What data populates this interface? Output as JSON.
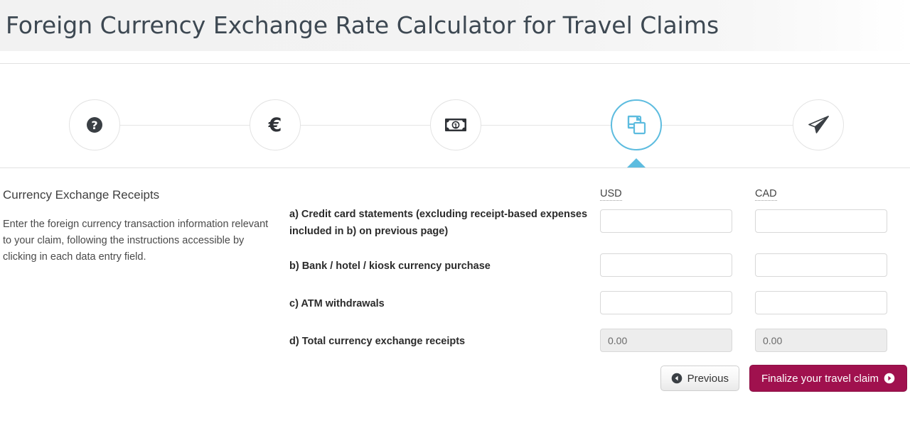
{
  "header": {
    "title": "Foreign Currency Exchange Rate Calculator for Travel Claims"
  },
  "stepper": {
    "active_index": 3,
    "active_color": "#5dbcdf",
    "inactive_border": "#e3e3e3",
    "steps": [
      {
        "icon": "question-mark-circle-icon",
        "label": "Help",
        "state": "inactive"
      },
      {
        "icon": "euro-currency-icon",
        "label": "Currency",
        "state": "inactive",
        "glyph": "€"
      },
      {
        "icon": "banknote-money-icon",
        "label": "Cash",
        "state": "inactive"
      },
      {
        "icon": "copy-documents-icon",
        "label": "Currency Exchange Receipts",
        "state": "active"
      },
      {
        "icon": "paper-plane-send-icon",
        "label": "Submit",
        "state": "inactive"
      }
    ]
  },
  "main": {
    "section_title": "Currency Exchange Receipts",
    "section_description": "Enter the foreign currency transaction information relevant to your claim, following the instructions accessible by clicking in each data entry field.",
    "columns": [
      {
        "code": "USD",
        "title": "USD"
      },
      {
        "code": "CAD",
        "title": "CAD"
      }
    ],
    "rows": [
      {
        "id": "a",
        "label": "a) Credit card statements (excluding receipt-based expenses included in b) on previous page)",
        "usd_value": "",
        "cad_value": "",
        "usd_placeholder": "",
        "cad_placeholder": "",
        "readonly": false
      },
      {
        "id": "b",
        "label": "b) Bank / hotel / kiosk currency purchase",
        "usd_value": "",
        "cad_value": "",
        "usd_placeholder": "",
        "cad_placeholder": "",
        "readonly": false
      },
      {
        "id": "c",
        "label": "c) ATM withdrawals",
        "usd_value": "",
        "cad_value": "",
        "usd_placeholder": "",
        "cad_placeholder": "",
        "readonly": false
      },
      {
        "id": "d",
        "label": "d) Total currency exchange receipts",
        "usd_value": "0.00",
        "cad_value": "0.00",
        "usd_placeholder": "0.00",
        "cad_placeholder": "0.00",
        "readonly": true
      }
    ]
  },
  "buttons": {
    "previous_label": "Previous",
    "previous_icon": "circle-arrow-left-icon",
    "finalize_label": "Finalize your travel claim",
    "finalize_icon": "circle-arrow-right-icon",
    "finalize_color": "#a0114e"
  }
}
